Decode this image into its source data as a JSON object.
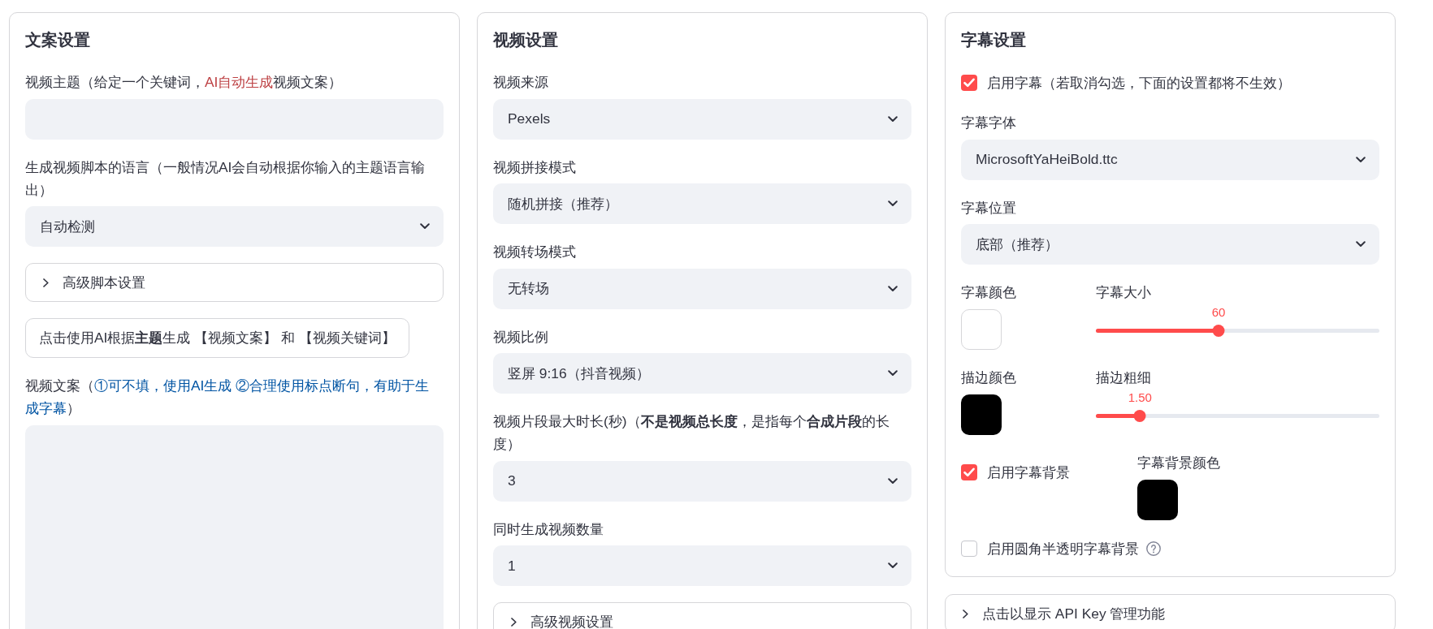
{
  "columns": [
    {
      "blocks": [
        {
          "kind": "card",
          "title": "文案设置",
          "controls": [
            {
              "kind": "text_input",
              "label_parts": [
                {
                  "text": "视频主题（给定一个关键词，"
                },
                {
                  "text": "AI自动生成",
                  "color": "#bd4043"
                },
                {
                  "text": "视频文案）"
                }
              ]
            },
            {
              "kind": "select",
              "label": "生成视频脚本的语言（一般情况AI会自动根据你输入的主题语言输出）",
              "value": "自动检测"
            },
            {
              "kind": "expander",
              "label": "高级脚本设置",
              "expanded": false
            },
            {
              "kind": "button",
              "label": "点击使用AI根据**主题**生成 【视频文案】 和 【视频关键词】"
            },
            {
              "kind": "textarea",
              "label_parts": [
                {
                  "text": "视频文案（"
                },
                {
                  "text": "①可不填，使用AI生成 ②合理使用标点断句，有助于生成字幕",
                  "color": "#0054a3"
                },
                {
                  "text": "）"
                }
              ]
            }
          ]
        }
      ]
    },
    {
      "blocks": [
        {
          "kind": "card",
          "title": "视频设置",
          "controls": [
            {
              "kind": "select",
              "label": "视频来源",
              "value": "Pexels"
            },
            {
              "kind": "select",
              "label": "视频拼接模式",
              "value": "随机拼接（推荐）"
            },
            {
              "kind": "select",
              "label": "视频转场模式",
              "value": "无转场"
            },
            {
              "kind": "select",
              "label": "视频比例",
              "value": "竖屏 9:16（抖音视频）"
            },
            {
              "kind": "select",
              "label": "视频片段最大时长(秒)（**不是视频总长度**，是指每个**合成片段**的长度）",
              "value": "3"
            },
            {
              "kind": "select",
              "label": "同时生成视频数量",
              "value": "1"
            },
            {
              "kind": "expander",
              "label": "高级视频设置",
              "expanded": false
            }
          ]
        }
      ]
    },
    {
      "blocks": [
        {
          "kind": "card",
          "title": "字幕设置",
          "controls": [
            {
              "kind": "checkbox",
              "label": "启用字幕（若取消勾选，下面的设置都将不生效）",
              "checked": true
            },
            {
              "kind": "select",
              "label": "字幕字体",
              "value": "MicrosoftYaHeiBold.ttc"
            },
            {
              "kind": "select",
              "label": "字幕位置",
              "value": "底部（推荐）"
            },
            {
              "kind": "columns",
              "cells": [
                {
                  "kind": "color",
                  "label": "字幕颜色",
                  "color": "#ffffff"
                },
                {
                  "kind": "slider",
                  "label": "字幕大小",
                  "reading": "60",
                  "level": 0.43
                }
              ]
            },
            {
              "kind": "columns",
              "cells": [
                {
                  "kind": "color",
                  "label": "描边颜色",
                  "color": "#000000"
                },
                {
                  "kind": "slider",
                  "label": "描边粗细",
                  "reading": "1.50",
                  "level": 0.14
                }
              ]
            },
            {
              "kind": "columns",
              "cells": [
                {
                  "kind": "checkbox",
                  "label": "启用字幕背景",
                  "checked": true
                },
                {
                  "kind": "color",
                  "label": "字幕背景颜色",
                  "color": "#000000"
                }
              ]
            },
            {
              "kind": "checkbox",
              "label": "启用圆角半透明字幕背景",
              "checked": false,
              "help": true
            }
          ]
        },
        {
          "kind": "expander",
          "label": "点击以显示 API Key 管理功能",
          "expanded": false
        }
      ]
    }
  ]
}
